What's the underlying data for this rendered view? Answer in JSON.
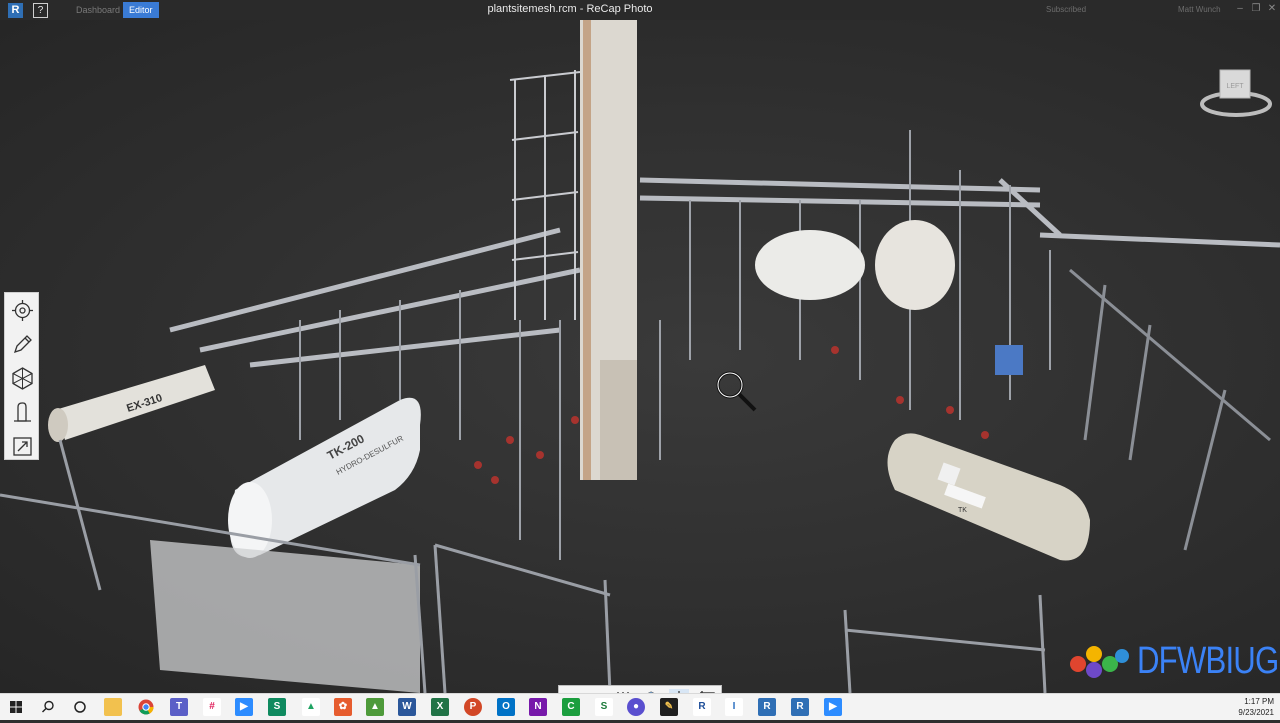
{
  "titlebar": {
    "logo_letter": "R",
    "help_label": "?",
    "tabs": [
      {
        "label": "Dashboard",
        "active": false
      },
      {
        "label": "Editor",
        "active": true
      }
    ],
    "window_title": "plantsitemesh.rcm - ReCap Photo",
    "subscribed_label": "Subscribed",
    "user_name": "Matt Wunch",
    "window_controls": [
      "minimize-icon",
      "restore-icon",
      "close-icon"
    ]
  },
  "scene": {
    "tank_label_1": "TK-200",
    "tank_label_1_sub": "HYDRO-DESULFUR",
    "pipe_label": "EX-310",
    "tank_label_2": "TK"
  },
  "viewcube": {
    "face_label": "LEFT"
  },
  "left_toolbar": [
    {
      "name": "settings-icon"
    },
    {
      "name": "pencil-icon"
    },
    {
      "name": "mesh-icon"
    },
    {
      "name": "measure-icon"
    },
    {
      "name": "export-icon"
    }
  ],
  "bottom_toolbar": [
    {
      "name": "undo-icon"
    },
    {
      "name": "redo-icon"
    },
    {
      "name": "adjust-icon"
    },
    {
      "name": "cube-icon"
    },
    {
      "name": "orbit-icon"
    },
    {
      "name": "crop-icon"
    }
  ],
  "brand": {
    "text": "DFWBIUG"
  },
  "taskbar": {
    "time": "1:17 PM",
    "date": "9/23/2021",
    "apps": [
      "windows-icon",
      "search-icon",
      "task-view-icon",
      "file-explorer-icon",
      "chrome-icon",
      "teams-icon",
      "slack-icon",
      "zoom-icon",
      "s-app-icon",
      "google-drive-icon",
      "r-app-icon",
      "map-app-icon",
      "word-icon",
      "excel-icon",
      "powerpoint-icon",
      "outlook-icon",
      "onenote-icon",
      "c-app-icon",
      "s2-app-icon",
      "vpn-icon",
      "notes-icon",
      "revit-icon",
      "i-app-icon",
      "recap-icon",
      "recap-pro-icon",
      "zoom2-icon"
    ]
  },
  "colors": {
    "accent": "#3a7bd5",
    "viewport_bg": "#2e2e2e",
    "brand_blue": "#3b82f6"
  }
}
